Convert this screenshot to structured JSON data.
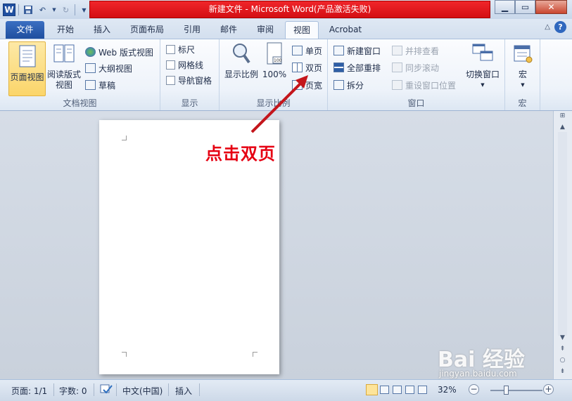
{
  "window": {
    "title": "新建文件 - Microsoft Word(产品激活失败)",
    "app_letter": "W"
  },
  "tabs": [
    {
      "label": "文件"
    },
    {
      "label": "开始"
    },
    {
      "label": "插入"
    },
    {
      "label": "页面布局"
    },
    {
      "label": "引用"
    },
    {
      "label": "邮件"
    },
    {
      "label": "审阅"
    },
    {
      "label": "视图"
    },
    {
      "label": "Acrobat"
    }
  ],
  "ribbon": {
    "doc_views": {
      "label": "文档视图",
      "print_layout": "页面视图",
      "reading_line1": "阅读版式",
      "reading_line2": "视图",
      "web": "Web 版式视图",
      "outline": "大纲视图",
      "draft": "草稿"
    },
    "show": {
      "label": "显示",
      "ruler": "标尺",
      "gridlines": "网格线",
      "nav_pane": "导航窗格"
    },
    "zoom": {
      "label": "显示比例",
      "zoom": "显示比例",
      "hundred": "100%",
      "one_page": "单页",
      "two_pages": "双页",
      "page_width": "页宽"
    },
    "window": {
      "label": "窗口",
      "new_window": "新建窗口",
      "arrange_all": "全部重排",
      "split": "拆分",
      "side_by_side": "并排查看",
      "sync_scroll": "同步滚动",
      "reset_position": "重设窗口位置",
      "switch_windows": "切换窗口"
    },
    "macros": {
      "label": "宏",
      "macros": "宏"
    }
  },
  "annotation": "点击双页",
  "status": {
    "page": "页面: 1/1",
    "words": "字数: 0",
    "language": "中文(中国)",
    "mode": "插入",
    "zoom_text": "32%",
    "zoom_fraction": 0.3
  },
  "watermark": {
    "brand": "Bai 经验",
    "url": "jingyan.baidu.com"
  }
}
